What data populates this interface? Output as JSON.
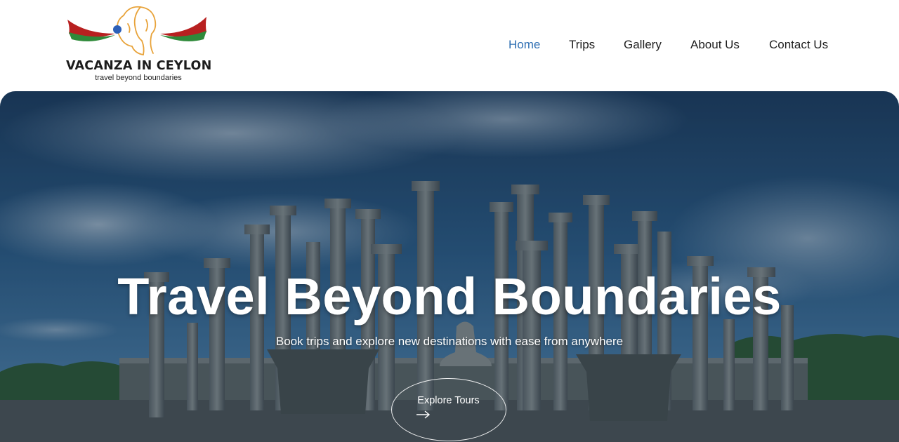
{
  "brand": {
    "name": "VACANZA IN CEYLON",
    "tagline": "travel beyond boundaries"
  },
  "nav": {
    "items": [
      {
        "label": "Home",
        "active": true
      },
      {
        "label": "Trips",
        "active": false
      },
      {
        "label": "Gallery",
        "active": false
      },
      {
        "label": "About Us",
        "active": false
      },
      {
        "label": "Contact Us",
        "active": false
      }
    ]
  },
  "hero": {
    "title": "Travel Beyond Boundaries",
    "subtitle": "Book trips and explore new destinations with ease from anywhere",
    "cta_label": "Explore Tours",
    "cta_icon": "arrow-right-icon",
    "background": "ancient-stone-pillars-image"
  },
  "colors": {
    "nav_active": "#2f6fb3",
    "nav_text": "#1e1e1e",
    "logo_red": "#b82020",
    "logo_green": "#2f8a3a",
    "logo_gold": "#e8a33a",
    "logo_blue": "#2c5fb8"
  }
}
